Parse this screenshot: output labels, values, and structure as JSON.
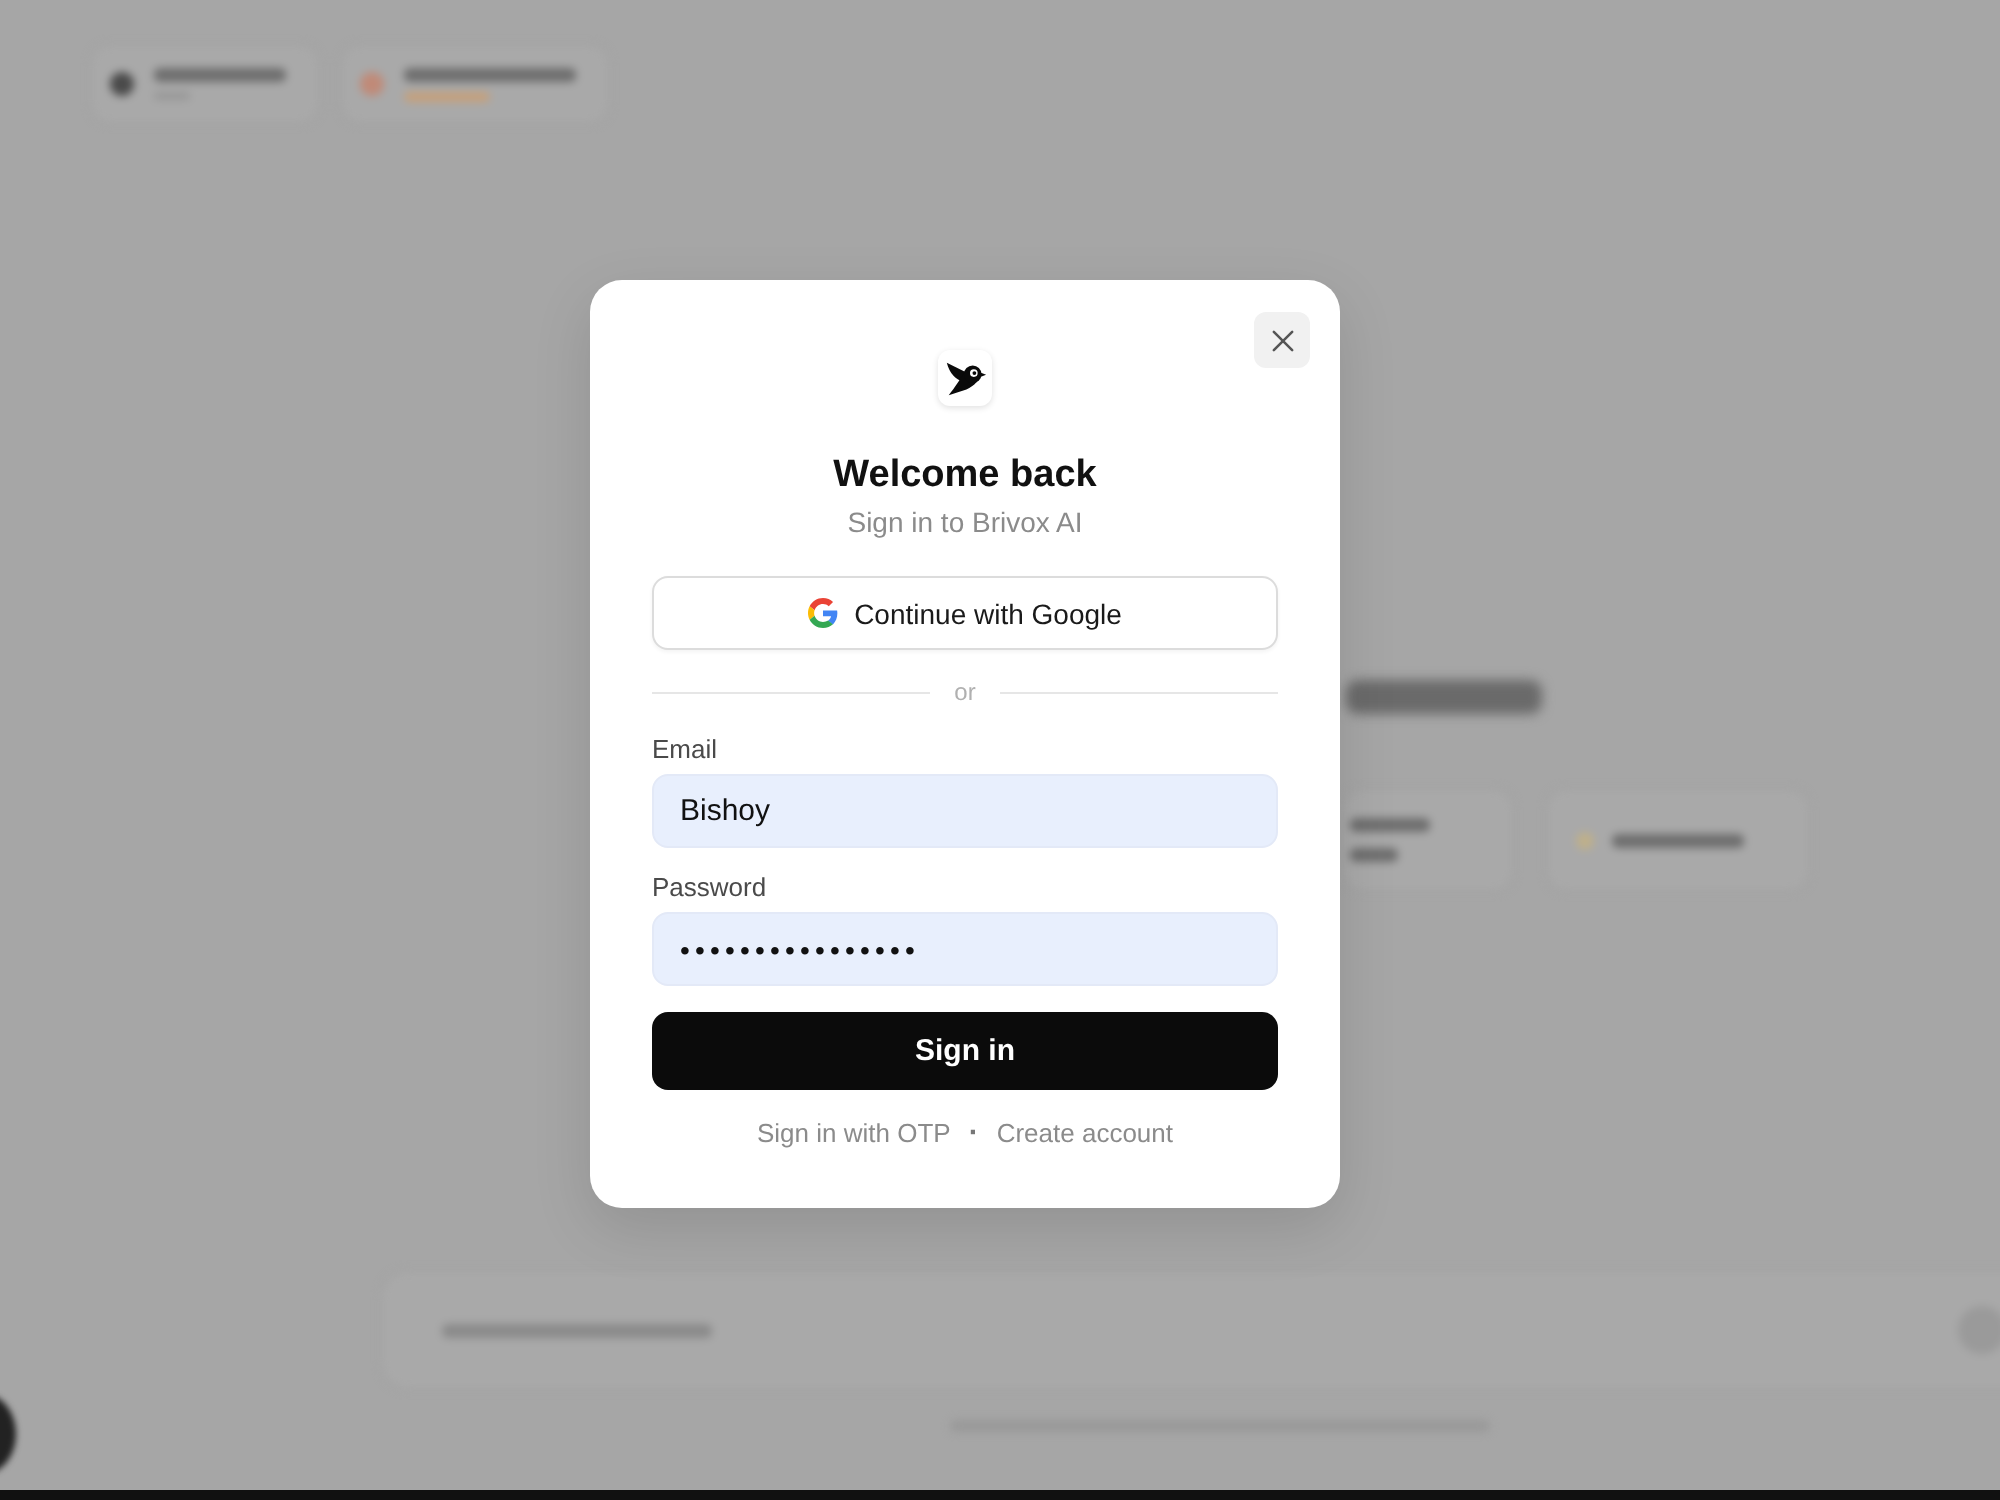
{
  "dialog": {
    "title": "Welcome back",
    "subtitle": "Sign in to Brivox AI",
    "google_button": "Continue with Google",
    "divider": "or",
    "fields": [
      {
        "label": "Email",
        "kind": "text",
        "value": "Bishoy",
        "autofilled": true
      },
      {
        "label": "Password",
        "kind": "password",
        "value": "••••••••••••••••",
        "autofilled": true
      }
    ],
    "submit_button": "Sign in",
    "links": [
      "Sign in with OTP",
      "Create account"
    ],
    "link_separator": "·"
  }
}
